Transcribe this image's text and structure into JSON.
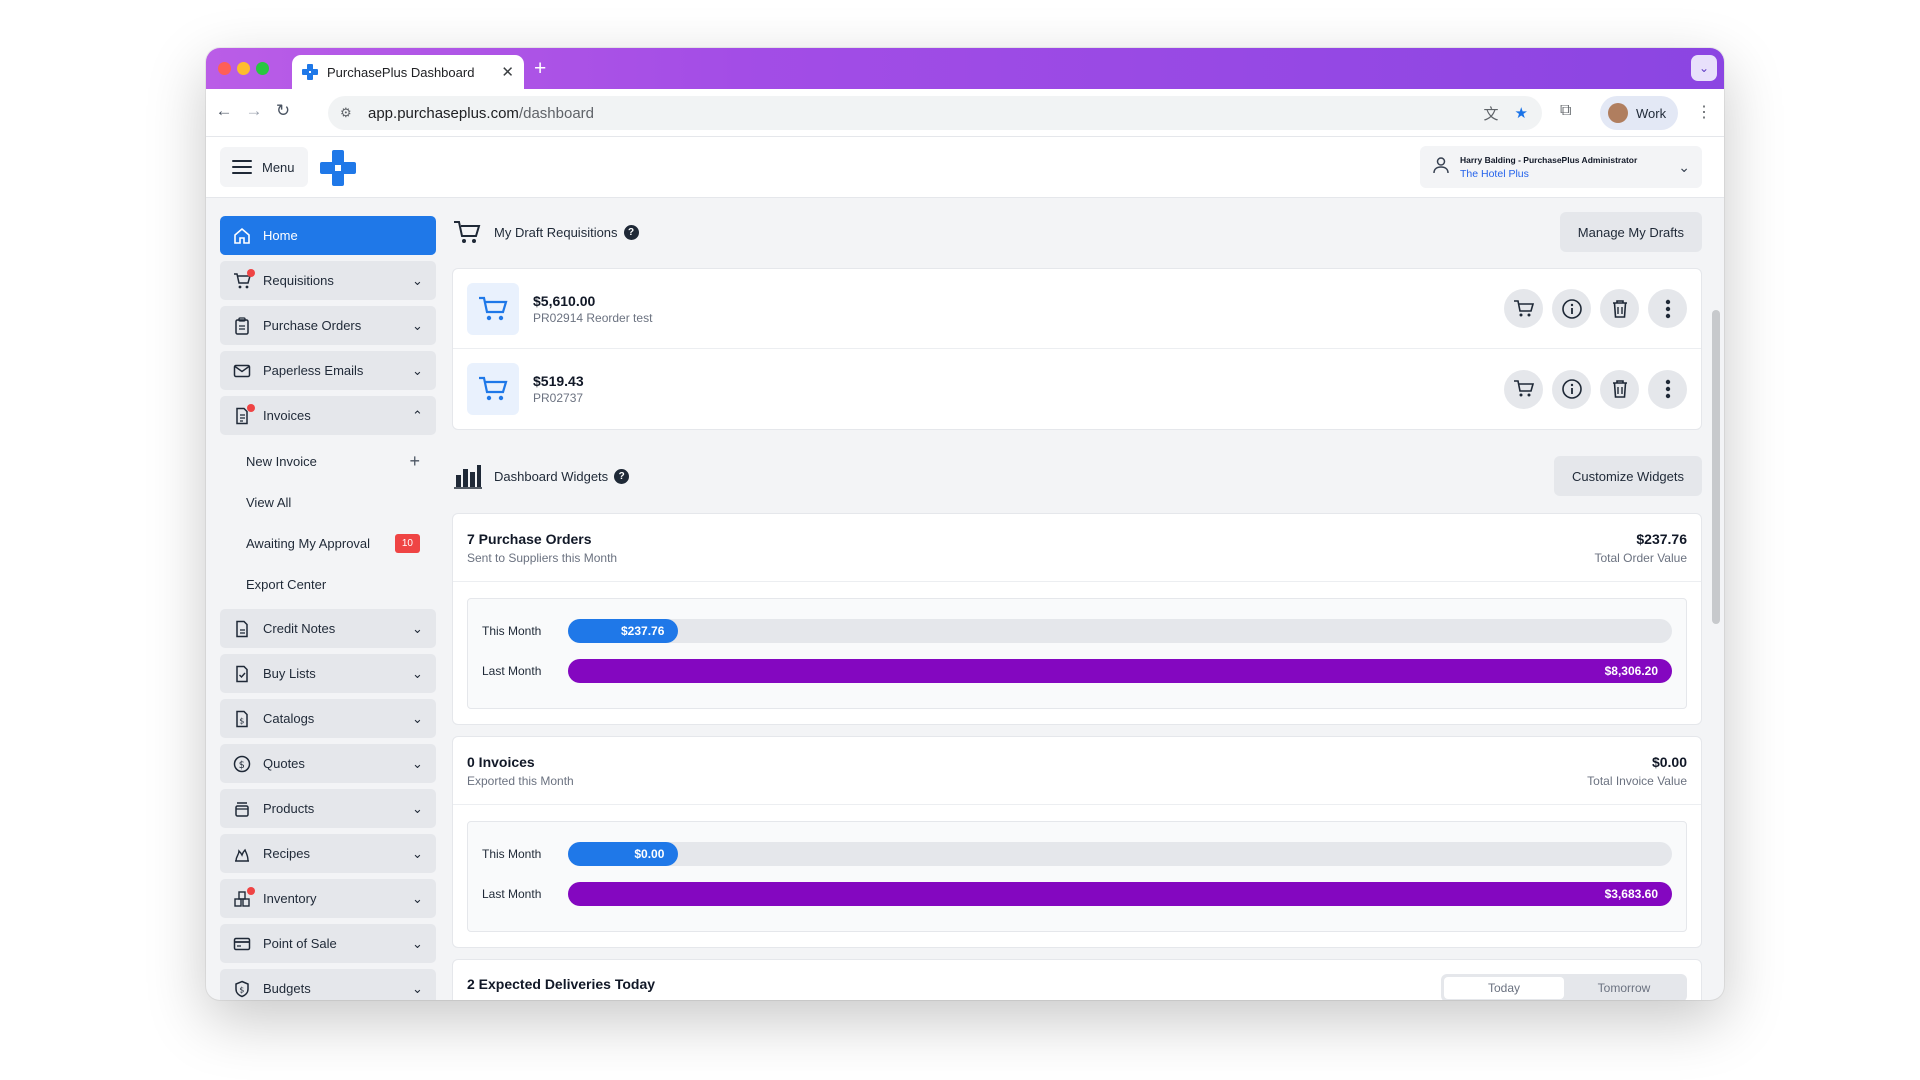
{
  "browser": {
    "tab_title": "PurchasePlus Dashboard",
    "url_host": "app.purchaseplus.com",
    "url_path": "/dashboard",
    "profile_label": "Work"
  },
  "header": {
    "menu_label": "Menu",
    "user_name": "Harry Balding - PurchasePlus Administrator",
    "user_org": "The Hotel Plus"
  },
  "sidebar": {
    "items": [
      {
        "label": "Home",
        "icon": "home-icon"
      },
      {
        "label": "Requisitions",
        "icon": "cart-icon"
      },
      {
        "label": "Purchase Orders",
        "icon": "clipboard-icon"
      },
      {
        "label": "Paperless Emails",
        "icon": "envelope-icon"
      },
      {
        "label": "Invoices",
        "icon": "document-icon"
      },
      {
        "label": "Credit Notes",
        "icon": "document-icon"
      },
      {
        "label": "Buy Lists",
        "icon": "checklist-icon"
      },
      {
        "label": "Catalogs",
        "icon": "dollar-doc-icon"
      },
      {
        "label": "Quotes",
        "icon": "dollar-circle-icon"
      },
      {
        "label": "Products",
        "icon": "products-icon"
      },
      {
        "label": "Recipes",
        "icon": "flame-icon"
      },
      {
        "label": "Inventory",
        "icon": "inventory-icon"
      },
      {
        "label": "Point of Sale",
        "icon": "credit-card-icon"
      },
      {
        "label": "Budgets",
        "icon": "shield-dollar-icon"
      }
    ],
    "invoice_sub": [
      {
        "label": "New Invoice"
      },
      {
        "label": "View All"
      },
      {
        "label": "Awaiting My Approval",
        "badge": "10"
      },
      {
        "label": "Export Center"
      }
    ]
  },
  "drafts": {
    "title": "My Draft Requisitions",
    "button": "Manage My Drafts",
    "rows": [
      {
        "amount": "$5,610.00",
        "ref": "PR02914 Reorder test"
      },
      {
        "amount": "$519.43",
        "ref": "PR02737"
      }
    ]
  },
  "widgets": {
    "title": "Dashboard Widgets",
    "button": "Customize Widgets",
    "purchase_orders": {
      "title": "7 Purchase Orders",
      "subtitle": "Sent to Suppliers this Month",
      "total": "$237.76",
      "total_label": "Total Order Value",
      "this_month_label": "This Month",
      "this_month_value": "$237.76",
      "this_month_fraction": 0.1,
      "last_month_label": "Last Month",
      "last_month_value": "$8,306.20",
      "last_month_fraction": 1.0
    },
    "invoices": {
      "title": "0 Invoices",
      "subtitle": "Exported this Month",
      "total": "$0.00",
      "total_label": "Total Invoice Value",
      "this_month_label": "This Month",
      "this_month_value": "$0.00",
      "this_month_fraction": 0.1,
      "last_month_label": "Last Month",
      "last_month_value": "$3,683.60",
      "last_month_fraction": 1.0
    },
    "deliveries": {
      "title": "2 Expected Deliveries Today",
      "tabs": [
        "Today",
        "Tomorrow"
      ]
    }
  },
  "colors": {
    "primary": "#1f78e8",
    "purple": "#8407c0",
    "alert": "#ef4444"
  }
}
